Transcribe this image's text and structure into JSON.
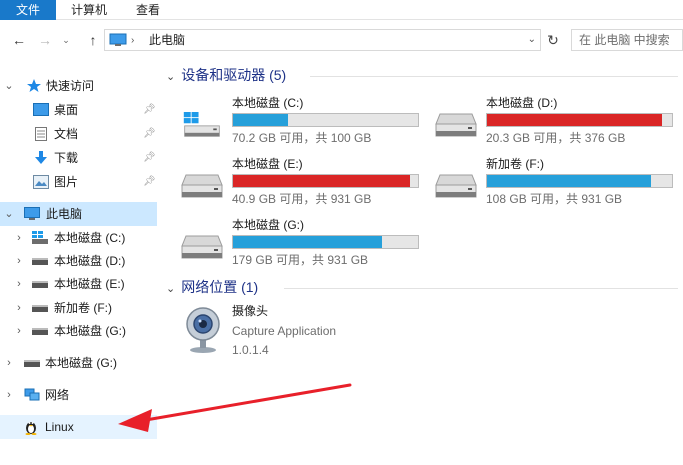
{
  "ribbon": {
    "tabs": [
      {
        "label": "文件",
        "active": true
      },
      {
        "label": "计算机",
        "active": false
      },
      {
        "label": "查看",
        "active": false
      }
    ]
  },
  "address": {
    "breadcrumb": "此电脑",
    "separator": "›",
    "dropdown_glyph": "⌄",
    "refresh_glyph": "↻",
    "search_placeholder": "在 此电脑 中搜索"
  },
  "nav_buttons": {
    "back": "←",
    "forward": "→",
    "recent": "⌄",
    "up": "↑"
  },
  "sidebar": {
    "quick_access": {
      "label": "快速访问",
      "icon": "star-icon"
    },
    "quick_items": [
      {
        "label": "桌面",
        "icon": "desktop-icon",
        "pinned": true
      },
      {
        "label": "文档",
        "icon": "documents-icon",
        "pinned": true
      },
      {
        "label": "下载",
        "icon": "download-icon",
        "pinned": true
      },
      {
        "label": "图片",
        "icon": "pictures-icon",
        "pinned": true
      }
    ],
    "this_pc": {
      "label": "此电脑",
      "icon": "computer-icon",
      "selected": true
    },
    "pc_items": [
      {
        "label": "本地磁盘 (C:)",
        "icon": "windows-drive-icon"
      },
      {
        "label": "本地磁盘 (D:)",
        "icon": "drive-icon"
      },
      {
        "label": "本地磁盘 (E:)",
        "icon": "drive-icon"
      },
      {
        "label": "新加卷 (F:)",
        "icon": "drive-icon"
      },
      {
        "label": "本地磁盘 (G:)",
        "icon": "drive-icon"
      }
    ],
    "g_drive": {
      "label": "本地磁盘 (G:)",
      "icon": "drive-icon"
    },
    "network": {
      "label": "网络",
      "icon": "network-icon"
    },
    "linux": {
      "label": "Linux",
      "icon": "linux-penguin-icon",
      "highlighted": true
    }
  },
  "content": {
    "devices_group": {
      "title": "设备和驱动器 (5)"
    },
    "drives": [
      {
        "name": "本地磁盘 (C:)",
        "info": "70.2 GB 可用，共 100 GB",
        "used_fraction": 0.298,
        "bar_color": "#26a0da",
        "icon": "windows-drive-icon"
      },
      {
        "name": "本地磁盘 (D:)",
        "info": "20.3 GB 可用，共 376 GB",
        "used_fraction": 0.946,
        "bar_color": "#da2626",
        "icon": "drive-icon"
      },
      {
        "name": "本地磁盘 (E:)",
        "info": "40.9 GB 可用，共 931 GB",
        "used_fraction": 0.956,
        "bar_color": "#da2626",
        "icon": "drive-icon"
      },
      {
        "name": "新加卷 (F:)",
        "info": "108 GB 可用，共 931 GB",
        "used_fraction": 0.884,
        "bar_color": "#26a0da",
        "icon": "drive-icon"
      },
      {
        "name": "本地磁盘 (G:)",
        "info": "179 GB 可用，共 931 GB",
        "used_fraction": 0.808,
        "bar_color": "#26a0da",
        "icon": "drive-icon"
      }
    ],
    "network_group": {
      "title": "网络位置 (1)"
    },
    "network_item": {
      "name": "摄像头",
      "subtitle": "Capture Application",
      "version": "1.0.1.4",
      "icon": "webcam-icon"
    }
  },
  "annotation": {
    "icon": "red-arrow-icon",
    "color": "#e8202a"
  }
}
